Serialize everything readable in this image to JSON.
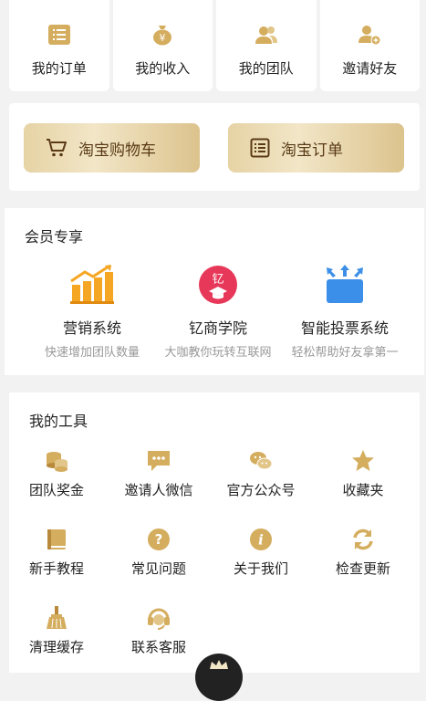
{
  "top_row": [
    {
      "label": "我的订单",
      "icon": "order-list-icon"
    },
    {
      "label": "我的收入",
      "icon": "money-bag-icon"
    },
    {
      "label": "我的团队",
      "icon": "team-icon"
    },
    {
      "label": "邀请好友",
      "icon": "invite-friend-icon"
    }
  ],
  "shop": {
    "cart_label": "淘宝购物车",
    "order_label": "淘宝订单"
  },
  "member": {
    "title": "会员专享",
    "items": [
      {
        "name": "营销系统",
        "desc": "快速增加团队数量",
        "icon": "bar-chart-growth-icon"
      },
      {
        "name": "钇商学院",
        "desc": "大咖教你玩转互联网",
        "icon": "academy-icon",
        "badge": "钇"
      },
      {
        "name": "智能投票系统",
        "desc": "轻松帮助好友拿第一",
        "icon": "vote-board-icon"
      }
    ]
  },
  "tools": {
    "title": "我的工具",
    "items": [
      {
        "label": "团队奖金",
        "icon": "coins-icon"
      },
      {
        "label": "邀请人微信",
        "icon": "chat-bubble-icon"
      },
      {
        "label": "官方公众号",
        "icon": "wechat-icon"
      },
      {
        "label": "收藏夹",
        "icon": "star-icon"
      },
      {
        "label": "新手教程",
        "icon": "book-icon"
      },
      {
        "label": "常见问题",
        "icon": "question-icon"
      },
      {
        "label": "关于我们",
        "icon": "info-icon"
      },
      {
        "label": "检查更新",
        "icon": "refresh-icon"
      },
      {
        "label": "清理缓存",
        "icon": "broom-icon"
      },
      {
        "label": "联系客服",
        "icon": "headset-icon"
      }
    ]
  },
  "colors": {
    "gold": "#d4ad5e",
    "gold_dark": "#b8893a",
    "brown_text": "#5a3b16",
    "orange": "#f5a623",
    "pink_red": "#e8385a",
    "blue": "#3b8fe8"
  }
}
